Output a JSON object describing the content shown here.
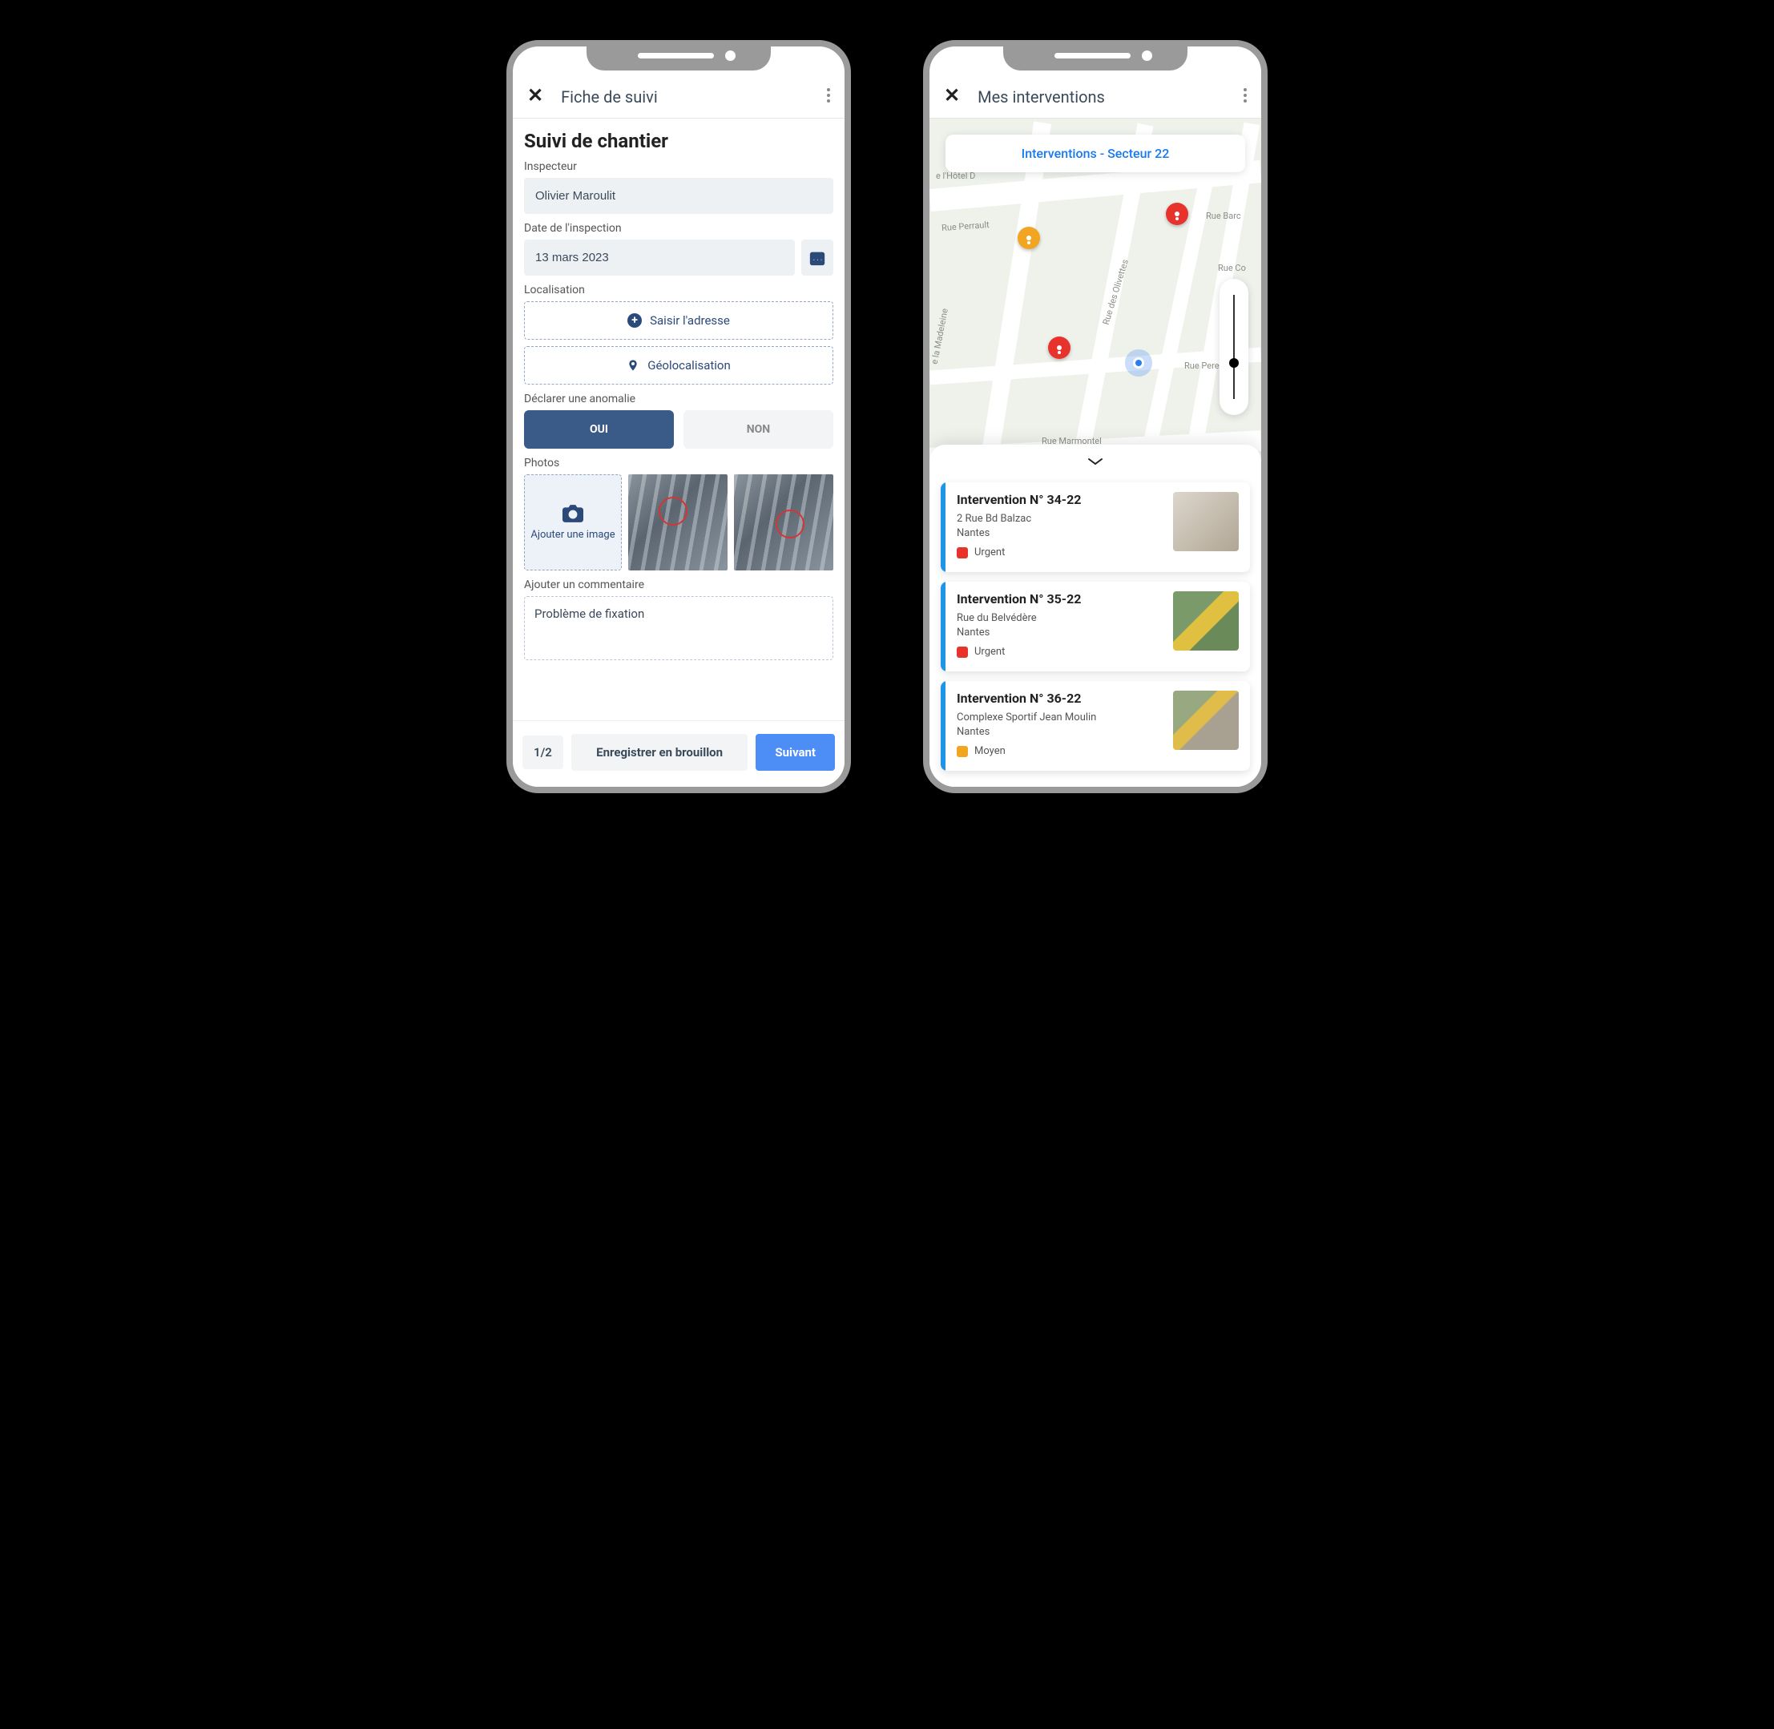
{
  "left": {
    "appbar_title": "Fiche de suivi",
    "page_title": "Suivi de chantier",
    "labels": {
      "inspector": "Inspecteur",
      "date": "Date de l'inspection",
      "location": "Localisation",
      "anomaly": "Déclarer une anomalie",
      "photos": "Photos",
      "comment": "Ajouter un commentaire"
    },
    "inspector_value": "Olivier Maroulit",
    "date_value": "13 mars 2023",
    "address_btn": "Saisir l'adresse",
    "geo_btn": "Géolocalisation",
    "yes": "OUI",
    "no": "NON",
    "add_image": "Ajouter une image",
    "comment_value": "Problème de fixation",
    "page_counter": "1/2",
    "draft_btn": "Enregistrer en brouillon",
    "next_btn": "Suivant"
  },
  "right": {
    "appbar_title": "Mes interventions",
    "sector_label": "Interventions  - Secteur 22",
    "streets": {
      "hotel": "e l'Hôtel D",
      "perrault": "Rue Perrault",
      "olivettes": "Rue des Olivettes",
      "barc": "Rue Barc",
      "co": "Rue Co",
      "pere": "Rue Pere",
      "madeleine": "e la Madeleine",
      "marmontel": "Rue Marmontel"
    },
    "cards": [
      {
        "title": "Intervention N° 34-22",
        "addr1": "2 Rue Bd Balzac",
        "addr2": "Nantes",
        "priority_label": "Urgent",
        "priority": "urgent",
        "thumb_class": "indoor"
      },
      {
        "title": "Intervention N° 35-22",
        "addr1": "Rue du Belvédère",
        "addr2": "Nantes",
        "priority_label": "Urgent",
        "priority": "urgent",
        "thumb_class": "excavator"
      },
      {
        "title": "Intervention N° 36-22",
        "addr1": "Complexe Sportif Jean Moulin",
        "addr2": "Nantes",
        "priority_label": "Moyen",
        "priority": "moyen",
        "thumb_class": "road"
      }
    ]
  }
}
